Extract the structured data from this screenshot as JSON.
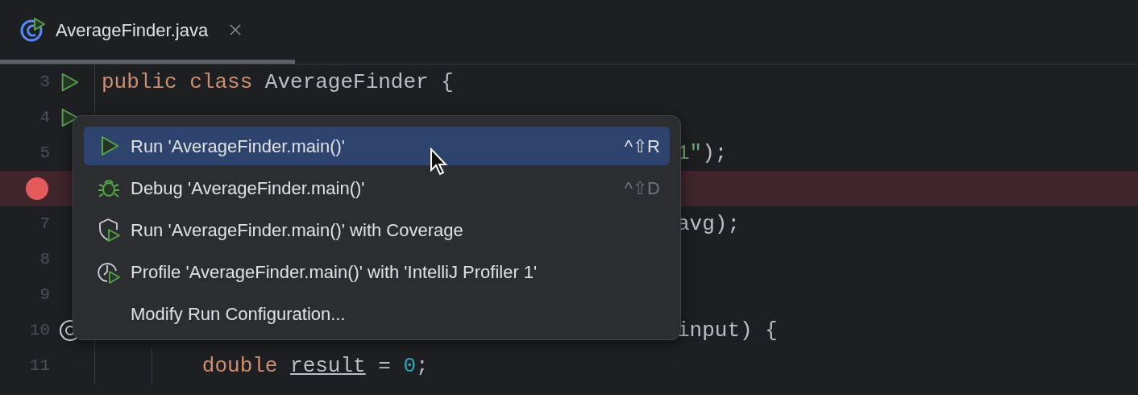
{
  "tab": {
    "title": "AverageFinder.java",
    "selected": true
  },
  "lines": [
    {
      "number": "3",
      "kind": "run",
      "code": [
        {
          "text": "public class ",
          "kind": "keyword"
        },
        {
          "text": "AverageFinder {",
          "kind": "plain"
        }
      ]
    },
    {
      "number": "4",
      "kind": "run"
    },
    {
      "number": "5",
      "kind": "plain",
      "visible_code_end": [
        {
          "text": "1\"",
          "kind": "string"
        },
        {
          "text": ");",
          "kind": "plain"
        }
      ]
    },
    {
      "kind": "breakpoint"
    },
    {
      "number": "7",
      "kind": "plain",
      "visible_code_end": [
        {
          "text": "avg);",
          "kind": "plain"
        }
      ]
    },
    {
      "number": "8",
      "kind": "plain"
    },
    {
      "number": "9",
      "kind": "plain"
    },
    {
      "number": "10",
      "kind": "at",
      "visible_code_end": [
        {
          "text": "input) {",
          "kind": "plain"
        }
      ]
    },
    {
      "number": "11",
      "kind": "plain",
      "code": [
        {
          "text": "        double ",
          "kind": "keyword"
        },
        {
          "text": "result",
          "kind": "variable"
        },
        {
          "text": " = ",
          "kind": "plain"
        },
        {
          "text": "0",
          "kind": "number"
        },
        {
          "text": ";",
          "kind": "plain"
        }
      ]
    }
  ],
  "popup_menu": [
    {
      "kind": "run",
      "label": "Run 'AverageFinder.main()'",
      "shortcut": "^⇧R",
      "selected": true
    },
    {
      "kind": "debug",
      "label": "Debug 'AverageFinder.main()'",
      "shortcut": "^⇧D",
      "selected": false
    },
    {
      "kind": "coverage",
      "label": "Run 'AverageFinder.main()' with Coverage",
      "selected": false
    },
    {
      "kind": "profile",
      "label": "Profile 'AverageFinder.main()' with 'IntelliJ Profiler 1'",
      "selected": false
    },
    {
      "kind": "plain",
      "label": "Modify Run Configuration...",
      "selected": false
    }
  ]
}
